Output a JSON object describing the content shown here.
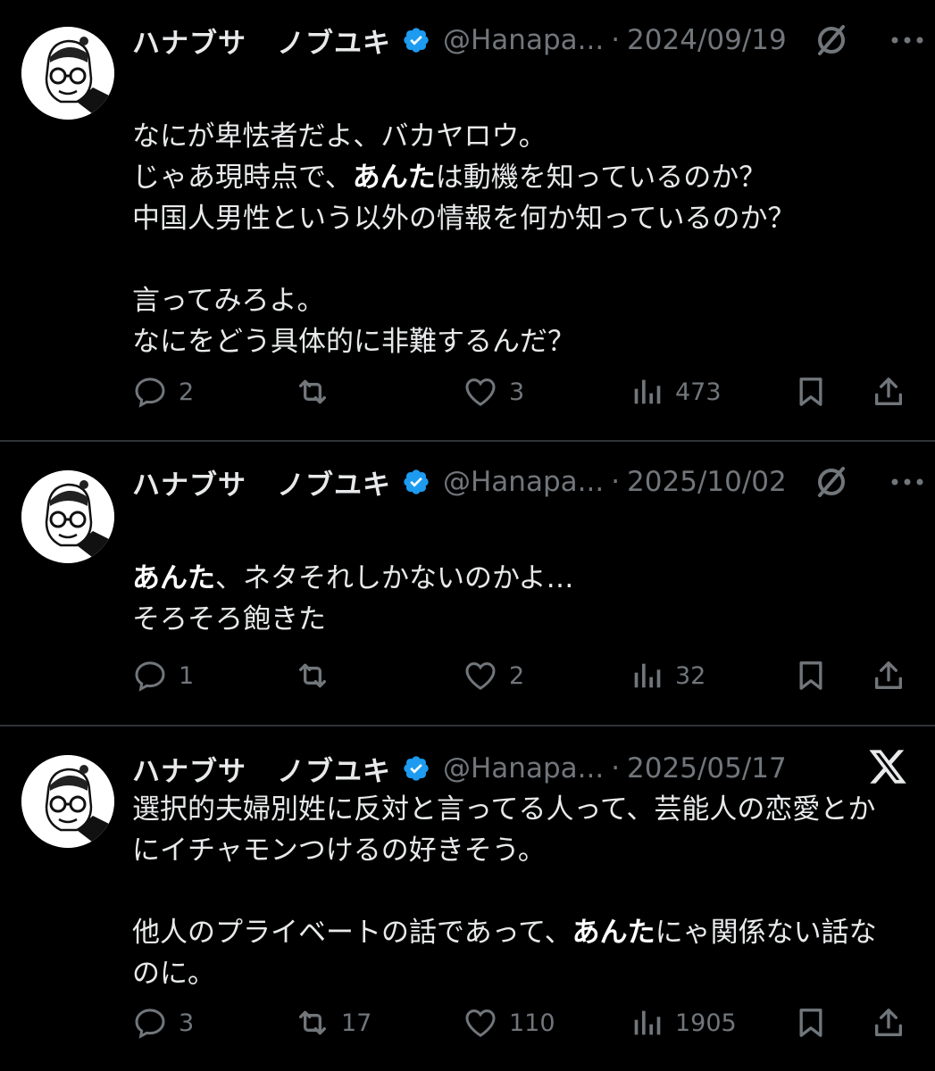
{
  "tweets": [
    {
      "author_name_part1": "ハナブサ",
      "author_name_part2": "ノブユキ",
      "handle": "@Hanapa...",
      "separator": "·",
      "date": "2024/09/19",
      "lines": [
        [
          {
            "t": "なにが卑怯者だよ、バカヤロウ。"
          }
        ],
        [
          {
            "t": "じゃあ現時点で、"
          },
          {
            "t": "あんた",
            "b": true
          },
          {
            "t": "は動機を知っているのか？"
          }
        ],
        [
          {
            "t": "中国人男性という以外の情報を何か知っているのか？"
          }
        ],
        [
          {
            "t": ""
          }
        ],
        [
          {
            "t": "言ってみろよ。"
          }
        ],
        [
          {
            "t": "なにをどう具体的に非難するんだ？"
          }
        ]
      ],
      "reply_count": "2",
      "retweet_count": "",
      "like_count": "3",
      "view_count": "473",
      "corner_icon": "grok-icon"
    },
    {
      "author_name_part1": "ハナブサ",
      "author_name_part2": "ノブユキ",
      "handle": "@Hanapa...",
      "separator": "·",
      "date": "2025/10/02",
      "lines": [
        [
          {
            "t": "あんた",
            "b": true
          },
          {
            "t": "、ネタそれしかないのかよ…"
          }
        ],
        [
          {
            "t": "そろそろ飽きた"
          }
        ]
      ],
      "reply_count": "1",
      "retweet_count": "",
      "like_count": "2",
      "view_count": "32",
      "corner_icon": "grok-icon"
    },
    {
      "author_name_part1": "ハナブサ",
      "author_name_part2": "ノブユキ",
      "handle": "@Hanapa...",
      "separator": "·",
      "date": "2025/05/17",
      "lines": [
        [
          {
            "t": "選択的夫婦別姓に反対と言ってる人って、芸能人の恋愛とか"
          }
        ],
        [
          {
            "t": "にイチャモンつけるの好きそう。"
          }
        ],
        [
          {
            "t": ""
          }
        ],
        [
          {
            "t": "他人のプライベートの話であって、"
          },
          {
            "t": "あんた",
            "b": true
          },
          {
            "t": "にゃ関係ない話な"
          }
        ],
        [
          {
            "t": "のに。"
          }
        ]
      ],
      "reply_count": "3",
      "retweet_count": "17",
      "like_count": "110",
      "view_count": "1905",
      "corner_icon": "x-logo-icon"
    }
  ],
  "colors": {
    "background": "#000000",
    "text": "#e7e9ea",
    "muted": "#71767b",
    "verified": "#1d9bf0",
    "divider": "#2f3336"
  }
}
